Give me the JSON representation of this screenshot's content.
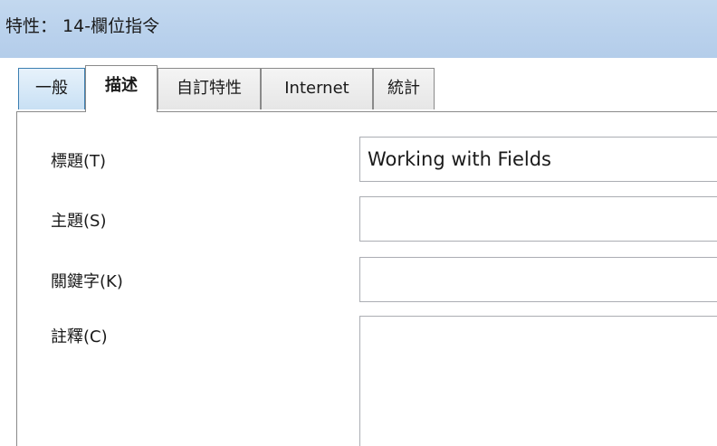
{
  "window": {
    "title": "特性： 14-欄位指令"
  },
  "tabs": [
    {
      "label": "一般",
      "state": "hover"
    },
    {
      "label": "描述",
      "state": "active"
    },
    {
      "label": "自訂特性",
      "state": "normal"
    },
    {
      "label": "Internet",
      "state": "normal"
    },
    {
      "label": "統計",
      "state": "normal"
    }
  ],
  "form": {
    "title": {
      "label": "標題(T)",
      "value": "Working with Fields"
    },
    "subject": {
      "label": "主題(S)",
      "value": ""
    },
    "keywords": {
      "label": "關鍵字(K)",
      "value": ""
    },
    "comments": {
      "label": "註釋(C)",
      "value": ""
    }
  },
  "colors": {
    "titlebar": "#b9d1ec",
    "tab_hover": "#c8e0f4",
    "border": "#8a8a8a"
  }
}
